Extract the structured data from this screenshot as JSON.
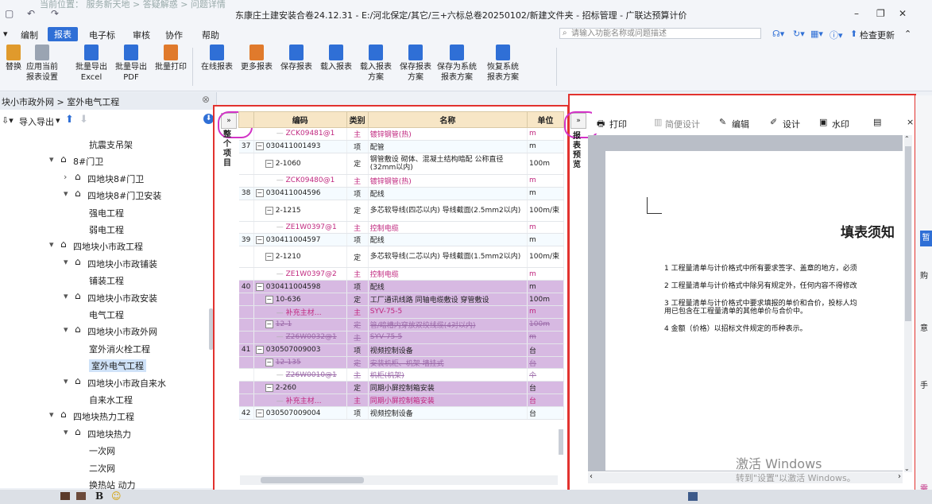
{
  "app": {
    "breadcrumb_top": "当前位置： 服务新天地 > 答疑解惑 > 问题详情",
    "window_title": "东康庄土建安装合卷24.12.31 - E:/河北保定/其它/三+六标总卷20250102/新建文件夹 - 招标管理 - 广联达预算计价"
  },
  "menu": {
    "items": [
      "编制",
      "报表",
      "电子标",
      "审核",
      "协作",
      "帮助"
    ],
    "active": "报表",
    "search_placeholder": "请输入功能名称或问题描述",
    "update_label": "检查更新"
  },
  "ribbon": {
    "left_buttons": [
      {
        "label": "替换",
        "color": "#e09a2c"
      },
      {
        "label": "应用当前\n报表设置",
        "color": "#9aa4b2"
      },
      {
        "label": "批量导出\nExcel",
        "color": "#2f6fd6"
      },
      {
        "label": "批量导出\nPDF",
        "color": "#2f6fd6"
      },
      {
        "label": "批量打印",
        "color": "#e07a2c"
      },
      {
        "label": "在线报表",
        "color": "#2f6fd6"
      },
      {
        "label": "更多报表",
        "color": "#e07a2c"
      },
      {
        "label": "保存报表",
        "color": "#2f6fd6"
      },
      {
        "label": "载入报表",
        "color": "#2f6fd6"
      },
      {
        "label": "载入报表\n方案",
        "color": "#2f6fd6"
      },
      {
        "label": "保存报表\n方案",
        "color": "#2f6fd6"
      },
      {
        "label": "保存为系统\n报表方案",
        "color": "#2f6fd6"
      },
      {
        "label": "恢复系统\n报表方案",
        "color": "#2f6fd6"
      }
    ]
  },
  "left_panel": {
    "breadcrumb": "块小市政外网 > 室外电气工程",
    "import_export": "导入导出",
    "tree": [
      {
        "label": "抗震支吊架",
        "indent": 4,
        "icon": false,
        "arrow": ""
      },
      {
        "label": "8#门卫",
        "indent": 2,
        "icon": true,
        "arrow": "▾"
      },
      {
        "label": "四地块8#门卫",
        "indent": 3,
        "icon": true,
        "arrow": "›"
      },
      {
        "label": "四地块8#门卫安装",
        "indent": 3,
        "icon": true,
        "arrow": "▾"
      },
      {
        "label": "强电工程",
        "indent": 4,
        "icon": false,
        "arrow": ""
      },
      {
        "label": "弱电工程",
        "indent": 4,
        "icon": false,
        "arrow": ""
      },
      {
        "label": "四地块小市政工程",
        "indent": 2,
        "icon": true,
        "arrow": "▾"
      },
      {
        "label": "四地块小市政铺装",
        "indent": 3,
        "icon": true,
        "arrow": "▾"
      },
      {
        "label": "铺装工程",
        "indent": 4,
        "icon": false,
        "arrow": ""
      },
      {
        "label": "四地块小市政安装",
        "indent": 3,
        "icon": true,
        "arrow": "▾"
      },
      {
        "label": "电气工程",
        "indent": 4,
        "icon": false,
        "arrow": ""
      },
      {
        "label": "四地块小市政外网",
        "indent": 3,
        "icon": true,
        "arrow": "▾"
      },
      {
        "label": "室外消火栓工程",
        "indent": 4,
        "icon": false,
        "arrow": ""
      },
      {
        "label": "室外电气工程",
        "indent": 4,
        "icon": false,
        "arrow": "",
        "selected": true
      },
      {
        "label": "四地块小市政自来水",
        "indent": 3,
        "icon": true,
        "arrow": "▾"
      },
      {
        "label": "自来水工程",
        "indent": 4,
        "icon": false,
        "arrow": ""
      },
      {
        "label": "四地块热力工程",
        "indent": 2,
        "icon": true,
        "arrow": "▾"
      },
      {
        "label": "四地块热力",
        "indent": 3,
        "icon": true,
        "arrow": "▾"
      },
      {
        "label": "一次网",
        "indent": 4,
        "icon": false,
        "arrow": ""
      },
      {
        "label": "二次网",
        "indent": 4,
        "icon": false,
        "arrow": ""
      },
      {
        "label": "换热站 动力",
        "indent": 4,
        "icon": false,
        "arrow": ""
      }
    ]
  },
  "grid": {
    "side_tab": "整个项目",
    "columns": [
      "编码",
      "类别",
      "名称",
      "单位"
    ],
    "rows": [
      {
        "no": "",
        "code": "ZCK09481@1",
        "type": "主",
        "name": "镀锌钢管(热)",
        "unit": "m",
        "style": "mag",
        "lvl": 2
      },
      {
        "no": "37",
        "code": "030411001493",
        "type": "项",
        "name": "配管",
        "unit": "m",
        "style": "m",
        "lvl": 0
      },
      {
        "no": "",
        "code": "2-1060",
        "type": "定",
        "name": "钢管敷设 砌体、混凝土结构暗配 公称直径(32mm以内)",
        "unit": "100m",
        "style": "",
        "lvl": 1,
        "tall": true
      },
      {
        "no": "",
        "code": "ZCK09480@1",
        "type": "主",
        "name": "镀锌钢管(热)",
        "unit": "m",
        "style": "mag",
        "lvl": 2
      },
      {
        "no": "38",
        "code": "030411004596",
        "type": "项",
        "name": "配线",
        "unit": "m",
        "style": "m",
        "lvl": 0
      },
      {
        "no": "",
        "code": "2-1215",
        "type": "定",
        "name": "多芯软导线(四芯以内) 导线截面(2.5mm2以内)",
        "unit": "100m/束",
        "style": "",
        "lvl": 1,
        "tall": true
      },
      {
        "no": "",
        "code": "ZE1W0397@1",
        "type": "主",
        "name": "控制电缆",
        "unit": "m",
        "style": "mag",
        "lvl": 2
      },
      {
        "no": "39",
        "code": "030411004597",
        "type": "项",
        "name": "配线",
        "unit": "m",
        "style": "m",
        "lvl": 0
      },
      {
        "no": "",
        "code": "2-1210",
        "type": "定",
        "name": "多芯软导线(二芯以内) 导线截面(1.5mm2以内)",
        "unit": "100m/束",
        "style": "",
        "lvl": 1,
        "tall": true
      },
      {
        "no": "",
        "code": "ZE1W0397@2",
        "type": "主",
        "name": "控制电缆",
        "unit": "m",
        "style": "mag",
        "lvl": 2
      },
      {
        "no": "40",
        "code": "030411004598",
        "type": "项",
        "name": "配线",
        "unit": "m",
        "style": "sel",
        "lvl": 0
      },
      {
        "no": "",
        "code": "10-636",
        "type": "定",
        "name": "工厂通讯线路 同轴电缆敷设 穿管敷设",
        "unit": "100m",
        "style": "sel",
        "lvl": 1
      },
      {
        "no": "",
        "code": "补充主材…",
        "type": "主",
        "name": "SYV-75-5",
        "unit": "m",
        "style": "sel-mag",
        "lvl": 2
      },
      {
        "no": "",
        "code": "12-1",
        "type": "定",
        "name": "管/暗槽内穿放双绞线缆(4对以内)",
        "unit": "100m",
        "style": "sel-strike",
        "lvl": 1
      },
      {
        "no": "",
        "code": "Z26W0032@1",
        "type": "主",
        "name": "SYV-75-5",
        "unit": "m",
        "style": "sel-strike",
        "lvl": 2
      },
      {
        "no": "41",
        "code": "030507009003",
        "type": "项",
        "name": "视频控制设备",
        "unit": "台",
        "style": "sel",
        "lvl": 0
      },
      {
        "no": "",
        "code": "12-135",
        "type": "定",
        "name": "安装机柜、机架 墙挂式",
        "unit": "台",
        "style": "sel-strike",
        "lvl": 1
      },
      {
        "no": "",
        "code": "Z26W0010@1",
        "type": "主",
        "name": "机柜(机架)",
        "unit": "个",
        "style": "strike",
        "lvl": 2
      },
      {
        "no": "",
        "code": "2-260",
        "type": "定",
        "name": "同期小屏控制箱安装",
        "unit": "台",
        "style": "sel",
        "lvl": 1
      },
      {
        "no": "",
        "code": "补充主材…",
        "type": "主",
        "name": "同期小屏控制箱安装",
        "unit": "台",
        "style": "sel-mag",
        "lvl": 2
      },
      {
        "no": "42",
        "code": "030507009004",
        "type": "项",
        "name": "视频控制设备",
        "unit": "台",
        "style": "m",
        "lvl": 0
      }
    ]
  },
  "preview": {
    "side_tab": "报表预览",
    "toolbar": [
      "打印",
      "简便设计",
      "编辑",
      "设计",
      "水印"
    ],
    "page_title": "填表须知",
    "lines": [
      "1  工程量清单与计价格式中所有要求签字、盖章的地方，必须",
      "2  工程量清单与计价格式中除另有规定外，任何内容不得修改",
      "3  工程量清单与计价格式中要求填报的单价和合价，投标人均",
      "用已包含在工程量清单的其他单价与合价中。",
      "4  金额（价格）以招标文件规定的币种表示。"
    ],
    "watermark1": "激活 Windows",
    "watermark2": "转到\"设置\"以激活 Windows。"
  },
  "right_edge": {
    "items": [
      "暂",
      "购",
      "意",
      "手",
      "需"
    ]
  },
  "taskbar": {
    "bold_label": "B"
  }
}
